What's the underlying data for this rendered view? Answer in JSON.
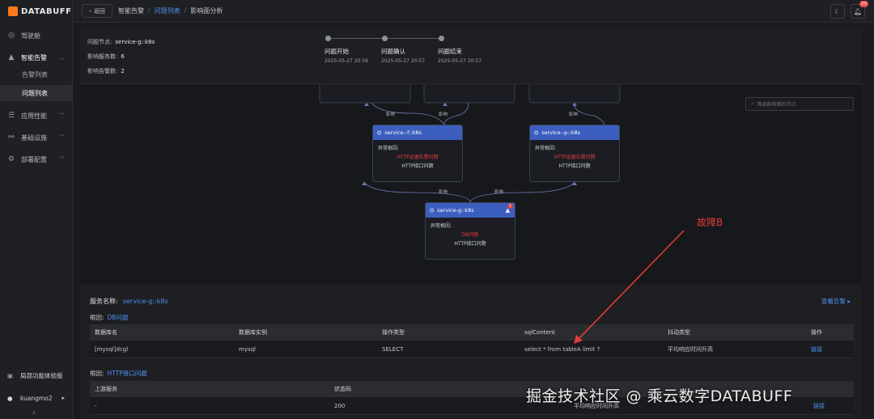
{
  "app": {
    "logo_text": "DATABUFF"
  },
  "sidebar": {
    "items": [
      {
        "label": "驾驶舱",
        "icon": "dashboard-icon"
      },
      {
        "label": "智能告警",
        "icon": "bell-icon"
      },
      {
        "label": "应用性能",
        "icon": "list-icon"
      },
      {
        "label": "基础设施",
        "icon": "server-icon"
      },
      {
        "label": "部署配置",
        "icon": "gear-icon"
      }
    ],
    "sub_items": [
      {
        "label": "告警列表"
      },
      {
        "label": "问题列表"
      }
    ],
    "bottom": {
      "trial_label": "局部功能体验版",
      "user_label": "kuangmo2"
    }
  },
  "topbar": {
    "back_label": "返回",
    "breadcrumb": [
      "智能告警",
      "问题列表",
      "影响面分析"
    ],
    "notification_count": "20"
  },
  "info": {
    "node_label": "问题节点:",
    "node_value": "service-g::k8s",
    "services_label": "影响服务数:",
    "services_value": "6",
    "alarms_label": "影响告警数:",
    "alarms_value": "2"
  },
  "timeline": [
    {
      "label": "问题开始",
      "time": "2025-05-27 20:56"
    },
    {
      "label": "问题确认",
      "time": "2025-05-27 20:57"
    },
    {
      "label": "问题结束",
      "time": "2025-05-27 20:57"
    }
  ],
  "graph": {
    "search_placeholder": "筛选影响面的节点",
    "edge_label": "影响",
    "nodes": [
      {
        "name": "service--f::k8s",
        "root_label": "异常根因:",
        "red_text": "HTTP证据告警问题",
        "text": "HTTP接口问题"
      },
      {
        "name": "service--p::k8s",
        "root_label": "异常根因:",
        "red_text": "HTTP证据告警问题",
        "text": "HTTP接口问题"
      },
      {
        "name": "service-g::k8s",
        "root_label": "异常根因:",
        "red_text": "DB问题",
        "text": "HTTP接口问题",
        "badge": "1"
      }
    ]
  },
  "annotation": {
    "label": "故障B"
  },
  "detail": {
    "service_label": "服务名称:",
    "service_value": "service-g::k8s",
    "view_alarms": "查看告警",
    "root1_label": "根因:",
    "root1_value": "DB问题",
    "db_table": {
      "headers": [
        "数据库名",
        "数据库实例",
        "操作类型",
        "sqlContent",
        "抖动类型",
        "操作"
      ],
      "rows": [
        [
          "[mysql]dcgl",
          "mysql",
          "SELECT",
          "select * from tableA limit ?",
          "平均响应时间升高",
          "链接"
        ]
      ]
    },
    "root2_label": "根因:",
    "root2_value": "HTTP接口问题",
    "http_table": {
      "headers": [
        "上游服务",
        "状态码",
        "",
        ""
      ],
      "rows": [
        [
          "-",
          "200",
          "平均响应时间升高",
          "链接"
        ]
      ]
    }
  },
  "watermark": "掘金技术社区 @ 乘云数字DATABUFF"
}
